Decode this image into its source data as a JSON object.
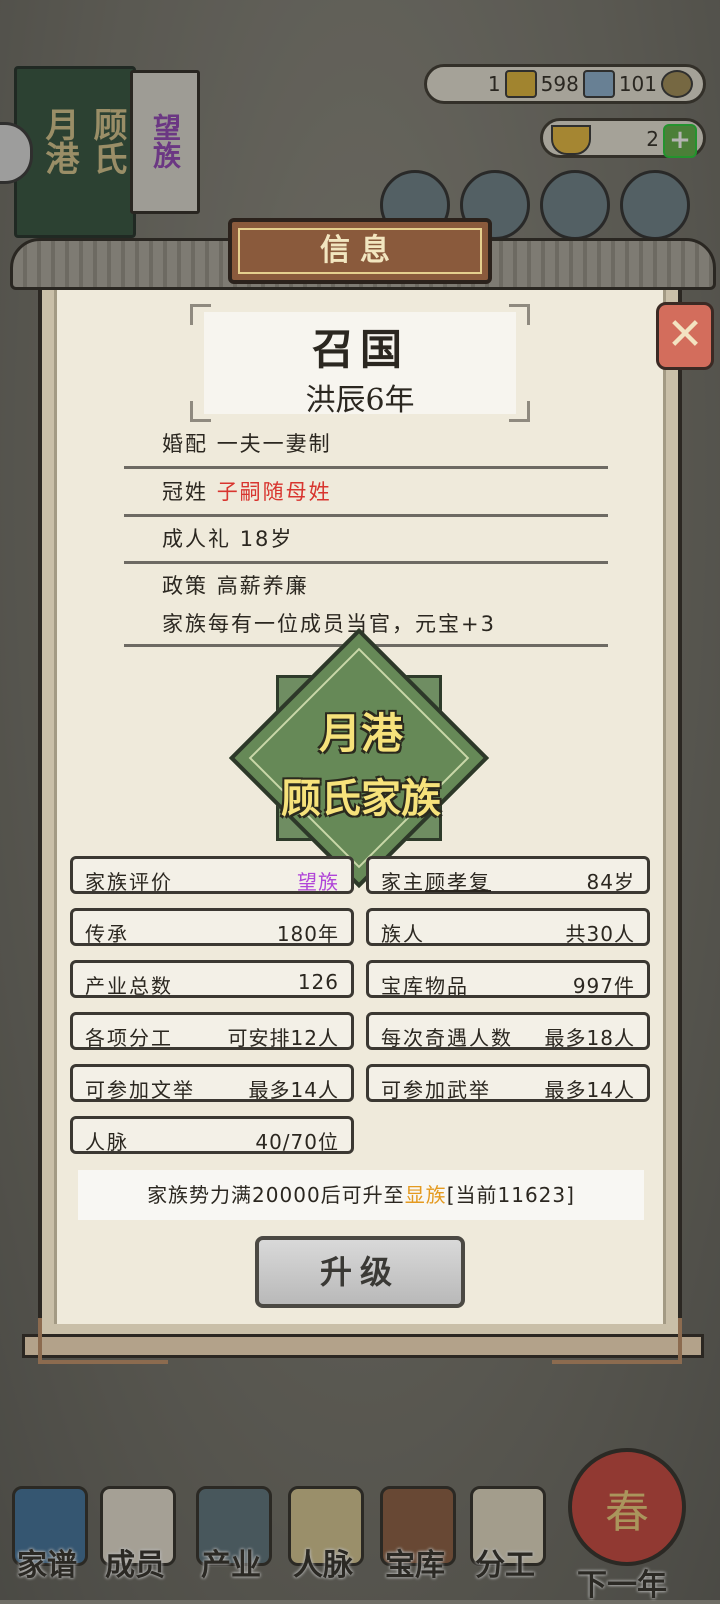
{
  "background": {
    "clan_book": {
      "place": "月港",
      "surname": "顾氏",
      "rank": "望族"
    },
    "resources": {
      "gold": "1",
      "silver": "598",
      "coins": "101"
    },
    "ingots": {
      "count": "2",
      "add": "+"
    },
    "icons": [
      "book-icon",
      "scroll-icon",
      "brush-icon",
      "settings-icon"
    ]
  },
  "dialog": {
    "title": "信息",
    "close": "✕",
    "nation": "召国",
    "era": "洪辰6年",
    "rows": [
      {
        "label": "婚配",
        "value": "一夫一妻制"
      },
      {
        "label": "冠姓",
        "value": "子嗣随母姓"
      },
      {
        "label": "成人礼",
        "value": "18岁"
      },
      {
        "label": "政策",
        "value": "高薪养廉",
        "detail": "家族每有一位成员当官，元宝+3"
      }
    ],
    "emblem": {
      "line1": "月港",
      "line2": "顾氏家族"
    },
    "stats": {
      "rating_label": "家族评价",
      "rating_value": "望族",
      "head_label": "家主",
      "head_name": "顾孝复",
      "head_age": "84岁",
      "legacy_label": "传承",
      "legacy_value": "180年",
      "members_label": "族人",
      "members_value": "共30人",
      "industry_label": "产业总数",
      "industry_value": "126",
      "treasury_label": "宝库物品",
      "treasury_value": "997件",
      "labor_label": "各项分工",
      "labor_value": "可安排12人",
      "encounter_label": "每次奇遇人数",
      "encounter_value": "最多18人",
      "civil_label": "可参加文举",
      "civil_value": "最多14人",
      "military_label": "可参加武举",
      "military_value": "最多14人",
      "network_label": "人脉",
      "network_value": "40/70位"
    },
    "hint": {
      "prefix": "家族势力满20000后可升至",
      "rank": "显族",
      "suffix": "[当前11623]"
    },
    "upgrade": "升级"
  },
  "nav": [
    "家谱",
    "成员",
    "产业",
    "人脉",
    "宝库",
    "分工",
    "下一年"
  ],
  "festival": "春",
  "colors": {
    "red": "#d8352f",
    "purple": "#b045d8",
    "orange": "#e49a1f",
    "emblem_green": "#668957"
  }
}
